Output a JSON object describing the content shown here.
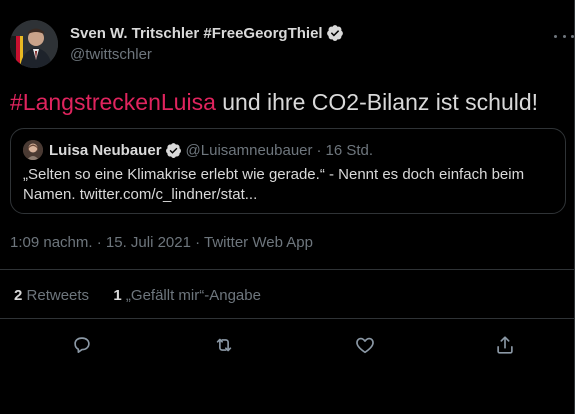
{
  "author": {
    "display_name": "Sven W. Tritschler #FreeGeorgThiel",
    "handle": "@twittschler"
  },
  "tweet": {
    "hashtag": "#LangstreckenLuisa",
    "text_rest": " und ihre CO2-Bilanz ist schuld!"
  },
  "quoted_tweet": {
    "display_name": "Luisa Neubauer",
    "handle": "@Luisamneubauer",
    "separator": "·",
    "time": "16 Std.",
    "text": "„Selten so eine Klimakrise erlebt wie gerade.“ - Nennt es doch einfach beim Namen. twitter.com/c_lindner/stat..."
  },
  "meta": {
    "timestamp": "1:09 nachm. · 15. Juli 2021 · Twitter Web App"
  },
  "stats": {
    "retweets_count": "2",
    "retweets_label": "Retweets",
    "likes_count": "1",
    "likes_label": "„Gefällt mir“-Angabe"
  },
  "colors": {
    "background": "#000000",
    "text": "#d9d9d9",
    "secondary": "#6e767d",
    "border": "#2f3336",
    "hashtag": "#e0245e"
  },
  "icons": {
    "verified": "verified-badge-icon",
    "reply": "reply-icon",
    "retweet": "retweet-icon",
    "like": "heart-icon",
    "share": "share-icon",
    "more": "more-icon"
  }
}
